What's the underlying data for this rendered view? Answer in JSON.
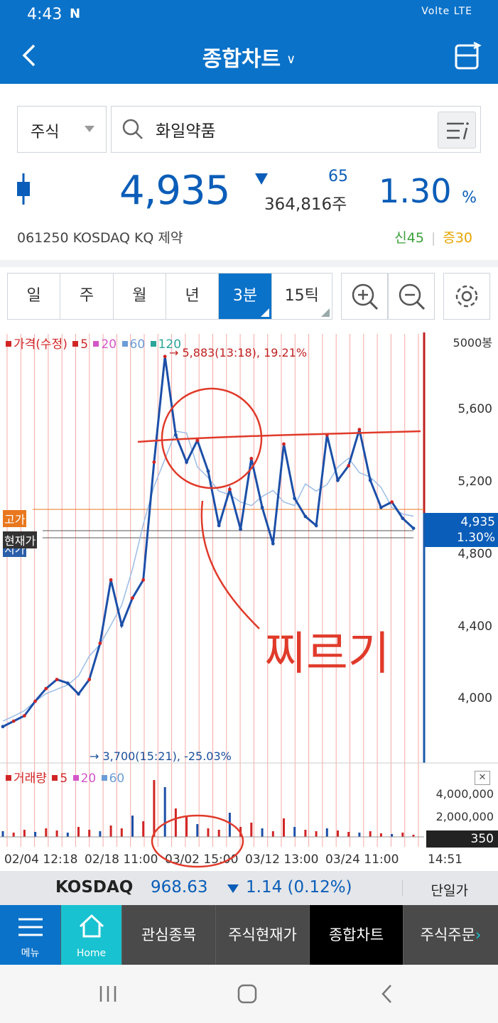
{
  "status": {
    "time": "4:43",
    "icons": "Volte LTE"
  },
  "header": {
    "title": "종합차트"
  },
  "search": {
    "type": "주식",
    "query": "화일약품"
  },
  "quote": {
    "price": "4,935",
    "change": "65",
    "volume": "364,816주",
    "pct": "1.30",
    "pct_unit": "%",
    "code": "061250  KOSDAQ  KQ 제약",
    "credit_new": "신45",
    "credit_margin": "증30"
  },
  "tabs": [
    "일",
    "주",
    "월",
    "년",
    "3분",
    "15틱"
  ],
  "chart": {
    "legend": {
      "price": "가격(수정)",
      "ma5": "5",
      "ma20": "20",
      "ma60": "60",
      "ma120": "120"
    },
    "units": "5000봉",
    "high_note": "→ 5,883(13:18), 19.21%",
    "low_note": "→ 3,700(15:21), -25.03%",
    "tag_high": "고가",
    "tag_current": "현재가",
    "tag_open": "시가",
    "current_price": "4,935",
    "current_pct": "1.30%",
    "volume_legend": {
      "label": "거래량",
      "ma5": "5",
      "ma20": "20",
      "ma60": "60"
    },
    "volume_ticks": [
      "4,000,000",
      "2,000,000"
    ],
    "volume_current": "350",
    "time_end": "14:51",
    "handwriting": "찌르기"
  },
  "chart_data": {
    "type": "line",
    "title": "",
    "x": [
      "02/04 12:18",
      "02/18 11:00",
      "03/02 15:00",
      "03/12 13:00",
      "03/24 11:00"
    ],
    "y_ticks": [
      "5,600",
      "5,200",
      "4,800",
      "4,400",
      "4,000"
    ],
    "ylim": [
      3700,
      5883
    ],
    "grid": true,
    "series": [
      {
        "values": [
          3840,
          3870,
          3900,
          3980,
          4050,
          4100,
          4080,
          4020,
          4100,
          4300,
          4650,
          4400,
          4550,
          4650,
          5300,
          5883,
          5450,
          5300,
          5420,
          5250,
          4950,
          5150,
          4930,
          5320,
          5050,
          4850,
          5400,
          5100,
          5000,
          4950,
          5450,
          5200,
          5280,
          5480,
          5200,
          5050,
          5080,
          4990,
          4935
        ]
      }
    ]
  },
  "index_bar": {
    "name": "KOSDAQ",
    "value": "968.63",
    "change": "1.14 (0.12%)",
    "unit": "단일가"
  },
  "bottom_nav": {
    "menu": "메뉴",
    "home": "Home",
    "watch": "관심종목",
    "quote": "주식현재가",
    "chart": "종합차트",
    "order": "주식주문"
  }
}
